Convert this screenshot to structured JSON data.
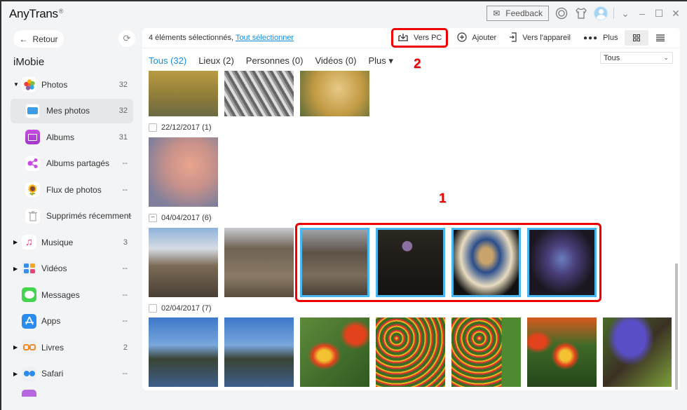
{
  "app": {
    "title": "AnyTrans",
    "reg": "®"
  },
  "titlebar": {
    "feedback": "Feedback",
    "icons": [
      "mail-icon",
      "support-icon",
      "skin-icon",
      "avatar",
      "menu-chevron-icon",
      "minimize-icon",
      "maximize-icon",
      "close-icon"
    ]
  },
  "sidebar": {
    "back": "Retour",
    "device": "iMobie",
    "items": [
      {
        "label": "Photos",
        "count": "32",
        "icon": "photos-icon",
        "arrow": "▼"
      },
      {
        "label": "Mes photos",
        "count": "32",
        "icon": "my-photos-icon",
        "selected": true
      },
      {
        "label": "Albums",
        "count": "31",
        "icon": "albums-icon"
      },
      {
        "label": "Albums partagés",
        "count": "--",
        "icon": "shared-albums-icon"
      },
      {
        "label": "Flux de photos",
        "count": "--",
        "icon": "photo-stream-icon"
      },
      {
        "label": "Supprimés récemment",
        "count": "--",
        "icon": "trash-icon"
      },
      {
        "label": "Musique",
        "count": "3",
        "icon": "music-icon",
        "arrow": "▶"
      },
      {
        "label": "Vidéos",
        "count": "--",
        "icon": "videos-icon",
        "arrow": "▶"
      },
      {
        "label": "Messages",
        "count": "--",
        "icon": "messages-icon"
      },
      {
        "label": "Apps",
        "count": "--",
        "icon": "apps-icon"
      },
      {
        "label": "Livres",
        "count": "2",
        "icon": "books-icon",
        "arrow": "▶"
      },
      {
        "label": "Safari",
        "count": "--",
        "icon": "safari-icon",
        "arrow": "▶"
      }
    ]
  },
  "toolbar": {
    "selected_text": "4 éléments sélectionnés,",
    "select_all": "Tout sélectionner",
    "to_pc": "Vers PC",
    "add": "Ajouter",
    "to_device": "Vers l'appareil",
    "more": "Plus"
  },
  "tabs": [
    {
      "label": "Tous (32)",
      "active": true
    },
    {
      "label": "Lieux (2)"
    },
    {
      "label": "Personnes (0)"
    },
    {
      "label": "Vidéos (0)"
    },
    {
      "label": "Plus ▾"
    }
  ],
  "filter": {
    "value": "Tous"
  },
  "annotations": {
    "a1": "1",
    "a2": "2"
  },
  "groups": [
    {
      "date": "22/12/2017 (1)",
      "check": ""
    },
    {
      "date": "04/04/2017 (6)",
      "check": "−"
    },
    {
      "date": "02/04/2017 (7)",
      "check": ""
    }
  ],
  "colors": {
    "accent": "#1a8ce0",
    "selection": "#4ab6f0",
    "annotation": "#e00000"
  }
}
